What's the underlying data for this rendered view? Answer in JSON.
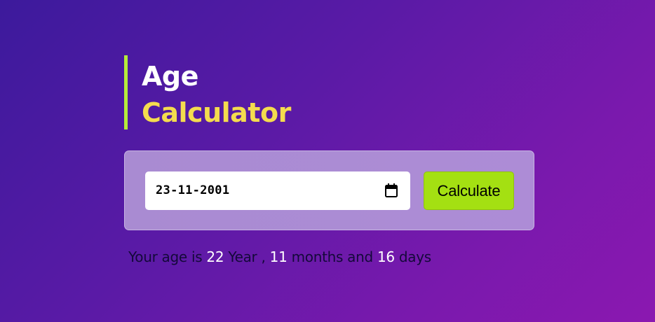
{
  "title": {
    "line1": "Age",
    "line2": "Calculator"
  },
  "form": {
    "date_value": "23-11-2001",
    "calculate_label": "Calculate"
  },
  "result": {
    "prefix": "Your age is",
    "years": "22",
    "years_label": "Year ,",
    "months": "11",
    "months_label": "months and",
    "days": "16",
    "days_label": "days"
  },
  "icons": {
    "date_picker": "calendar-icon"
  },
  "colors": {
    "accent_bar": "#b6ec3a",
    "title_primary": "#ffffff",
    "title_secondary": "#f4dc4e",
    "button": "#a4e012",
    "result_text": "#14093a",
    "result_numbers": "#ffffff"
  }
}
